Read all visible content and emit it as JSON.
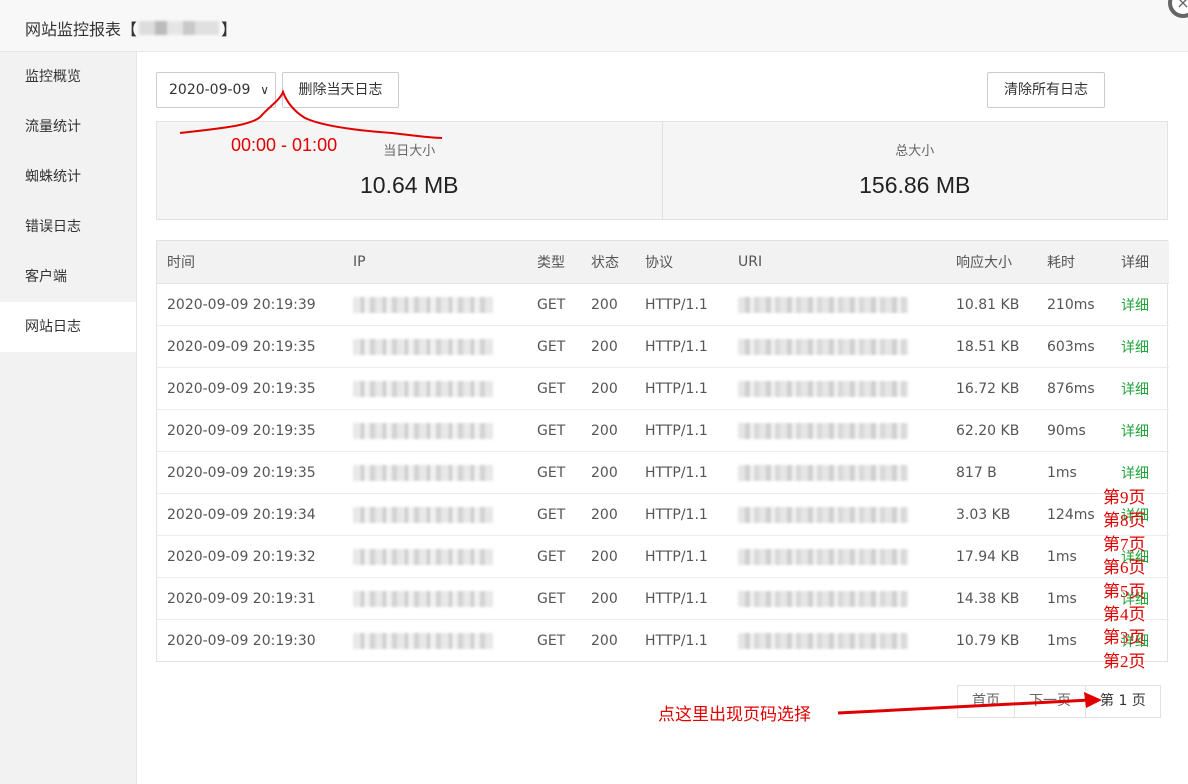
{
  "window": {
    "title_prefix": "网站监控报表【",
    "title_suffix": "】",
    "close_glyph": "×"
  },
  "sidebar": {
    "items": [
      {
        "label": "监控概览"
      },
      {
        "label": "流量统计"
      },
      {
        "label": "蜘蛛统计"
      },
      {
        "label": "错误日志"
      },
      {
        "label": "客户端"
      },
      {
        "label": "网站日志",
        "active": true
      }
    ]
  },
  "toolbar": {
    "date_value": "2020-09-09",
    "date_chevron": "∨",
    "delete_day_label": "删除当天日志",
    "clear_all_label": "清除所有日志"
  },
  "stats": {
    "day_size_label": "当日大小",
    "day_size_value": "10.64 MB",
    "total_size_label": "总大小",
    "total_size_value": "156.86 MB"
  },
  "table": {
    "headers": [
      "时间",
      "IP",
      "类型",
      "状态",
      "协议",
      "URI",
      "响应大小",
      "耗时",
      "详细"
    ],
    "rows": [
      {
        "time": "2020-09-09 20:19:39",
        "type": "GET",
        "status": "200",
        "protocol": "HTTP/1.1",
        "size": "10.81 KB",
        "duration": "210ms",
        "detail": "详细"
      },
      {
        "time": "2020-09-09 20:19:35",
        "type": "GET",
        "status": "200",
        "protocol": "HTTP/1.1",
        "size": "18.51 KB",
        "duration": "603ms",
        "detail": "详细"
      },
      {
        "time": "2020-09-09 20:19:35",
        "type": "GET",
        "status": "200",
        "protocol": "HTTP/1.1",
        "size": "16.72 KB",
        "duration": "876ms",
        "detail": "详细"
      },
      {
        "time": "2020-09-09 20:19:35",
        "type": "GET",
        "status": "200",
        "protocol": "HTTP/1.1",
        "size": "62.20 KB",
        "duration": "90ms",
        "detail": "详细"
      },
      {
        "time": "2020-09-09 20:19:35",
        "type": "GET",
        "status": "200",
        "protocol": "HTTP/1.1",
        "size": "817 B",
        "duration": "1ms",
        "detail": "详细"
      },
      {
        "time": "2020-09-09 20:19:34",
        "type": "GET",
        "status": "200",
        "protocol": "HTTP/1.1",
        "size": "3.03 KB",
        "duration": "124ms",
        "detail": "详细"
      },
      {
        "time": "2020-09-09 20:19:32",
        "type": "GET",
        "status": "200",
        "protocol": "HTTP/1.1",
        "size": "17.94 KB",
        "duration": "1ms",
        "detail": "详细"
      },
      {
        "time": "2020-09-09 20:19:31",
        "type": "GET",
        "status": "200",
        "protocol": "HTTP/1.1",
        "size": "14.38 KB",
        "duration": "1ms",
        "detail": "详细"
      },
      {
        "time": "2020-09-09 20:19:30",
        "type": "GET",
        "status": "200",
        "protocol": "HTTP/1.1",
        "size": "10.79 KB",
        "duration": "1ms",
        "detail": "详细"
      }
    ]
  },
  "pagination": {
    "first_label": "首页",
    "next_label": "下一页",
    "current_label": "第 1 页",
    "page_options": [
      "第9页",
      "第8页",
      "第7页",
      "第6页",
      "第5页",
      "第4页",
      "第3页",
      "第2页"
    ]
  },
  "annotations": {
    "time_range": "00:00 - 01:00",
    "page_hint": "点这里出现页码选择",
    "color": "#e00000"
  },
  "colors": {
    "accent_green": "#20a53a",
    "annotation_red": "#e00000"
  }
}
